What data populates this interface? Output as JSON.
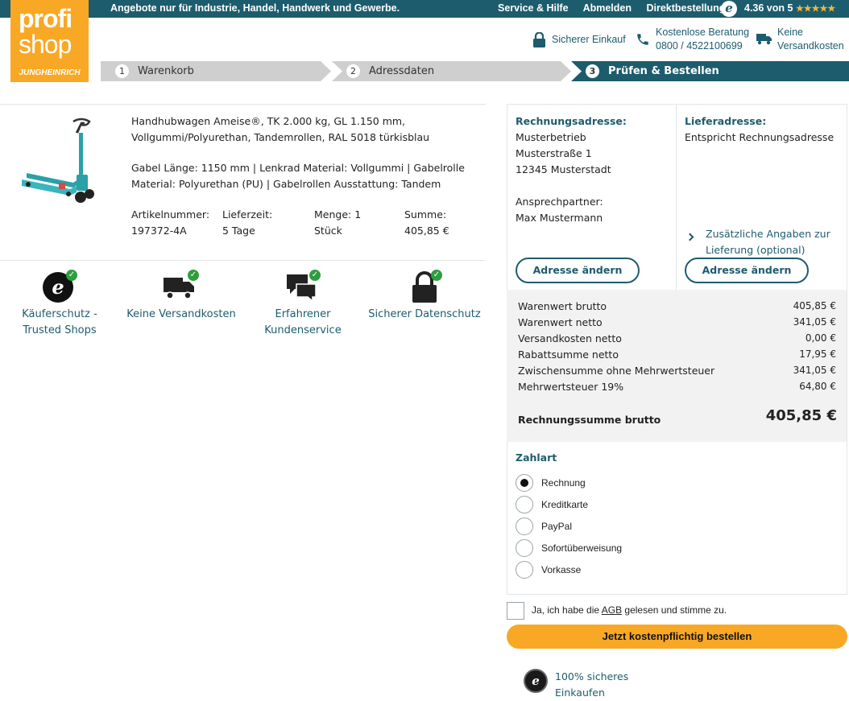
{
  "topbar": {
    "claim": "Angebote nur für Industrie, Handel, Handwerk und Gewerbe.",
    "links": [
      "Service & Hilfe",
      "Abmelden",
      "Direktbestellung"
    ],
    "rating_text": "4.36 von 5",
    "stars": "★★★★★"
  },
  "logo": {
    "line1": "profi",
    "line2": "shop",
    "brand": "JUNGHEINRICH"
  },
  "header": {
    "secure": "Sicherer Einkauf",
    "consult_line1": "Kostenlose Beratung",
    "consult_line2": "0800 / 4522100699",
    "shipping_line1": "Keine",
    "shipping_line2": "Versandkosten"
  },
  "steps": [
    {
      "num": "1",
      "label": "Warenkorb"
    },
    {
      "num": "2",
      "label": "Adressdaten"
    },
    {
      "num": "3",
      "label": "Prüfen & Bestellen"
    }
  ],
  "colors": {
    "primary": "#1d5c6d",
    "accent": "#f9a825",
    "step_inactive": "#cfcfcf",
    "success": "#2e9e3e"
  },
  "product": {
    "title_line1": "Handhubwagen Ameise®, TK 2.000 kg, GL 1.150 mm,",
    "title_line2": "Vollgummi/Polyurethan, Tandemrollen, RAL 5018 türkisblau",
    "attrs_line1": "Gabel Länge: 1150 mm | Lenkrad Material: Vollgummi | Gabelrolle",
    "attrs_line2": "Material: Polyurethan (PU) | Gabelrollen Ausstattung: Tandem",
    "columns": [
      {
        "label": "Artikelnummer:",
        "value": "197372-4A"
      },
      {
        "label": "Lieferzeit:",
        "value": "5 Tage"
      },
      {
        "label": "Menge: 1",
        "value": "Stück"
      },
      {
        "label": "Summe:",
        "value": "405,85 €"
      }
    ]
  },
  "badges": [
    {
      "icon": "trusted-shops-icon",
      "line1": "Käuferschutz -",
      "line2": "Trusted Shops"
    },
    {
      "icon": "truck-icon",
      "line1": "Keine Versandkosten",
      "line2": ""
    },
    {
      "icon": "chat-icon",
      "line1": "Erfahrener",
      "line2": "Kundenservice"
    },
    {
      "icon": "lock-icon",
      "line1": "Sicherer Datenschutz",
      "line2": ""
    }
  ],
  "billing": {
    "heading": "Rechnungsadresse:",
    "company": "Musterbetrieb",
    "street": "Musterstraße 1",
    "city": "12345 Musterstadt",
    "contact_label": "Ansprechpartner:",
    "contact_name": "Max Mustermann",
    "button": "Adresse ändern"
  },
  "delivery": {
    "heading": "Lieferadresse:",
    "text": "Entspricht Rechnungsadresse",
    "extra_line1": "Zusätzliche Angaben zur",
    "extra_line2": "Lieferung (optional)",
    "button": "Adresse ändern"
  },
  "summary": {
    "rows": [
      {
        "label": "Warenwert brutto",
        "value": "405,85 €"
      },
      {
        "label": "Warenwert netto",
        "value": "341,05 €"
      },
      {
        "label": "Versandkosten netto",
        "value": "0,00 €"
      },
      {
        "label": "Rabattsumme netto",
        "value": "17,95 €"
      },
      {
        "label": "Zwischensumme ohne Mehrwertsteuer",
        "value": "341,05 €"
      },
      {
        "label": "Mehrwertsteuer 19%",
        "value": "64,80 €"
      }
    ],
    "total_label": "Rechnungssumme brutto",
    "total_value": "405,85 €"
  },
  "payment": {
    "heading": "Zahlart",
    "selected": "Rechnung",
    "options": [
      "Rechnung",
      "Kreditkarte",
      "PayPal",
      "Sofortüberweisung",
      "Vorkasse"
    ]
  },
  "agb": {
    "pre": "Ja, ich habe die ",
    "link": "AGB",
    "post": " gelesen und stimme zu."
  },
  "order_button": "Jetzt kostenpflichtig bestellen",
  "seal": {
    "line1": "100% sicheres",
    "line2": "Einkaufen"
  }
}
